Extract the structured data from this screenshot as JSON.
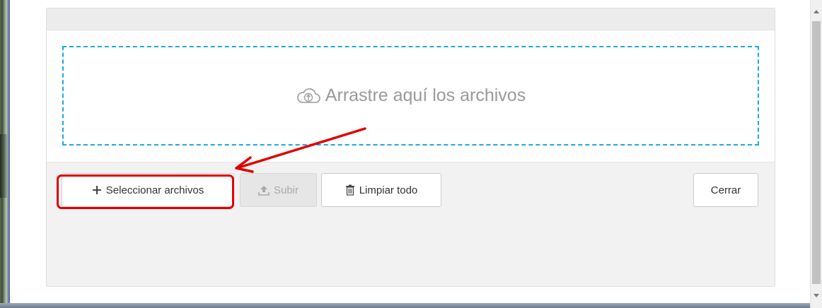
{
  "dropzone": {
    "text": "Arrastre aquí los archivos",
    "icon": "cloud-upload-icon",
    "border_color": "#1aa9e8"
  },
  "toolbar": {
    "select_label": "Seleccionar archivos",
    "select_icon": "plus-icon",
    "upload_label": "Subir",
    "upload_icon": "upload-icon",
    "clear_label": "Limpiar todo",
    "clear_icon": "trash-icon",
    "close_label": "Cerrar"
  },
  "annotation": {
    "highlight_color": "#e00000",
    "target": "select-files-button"
  }
}
